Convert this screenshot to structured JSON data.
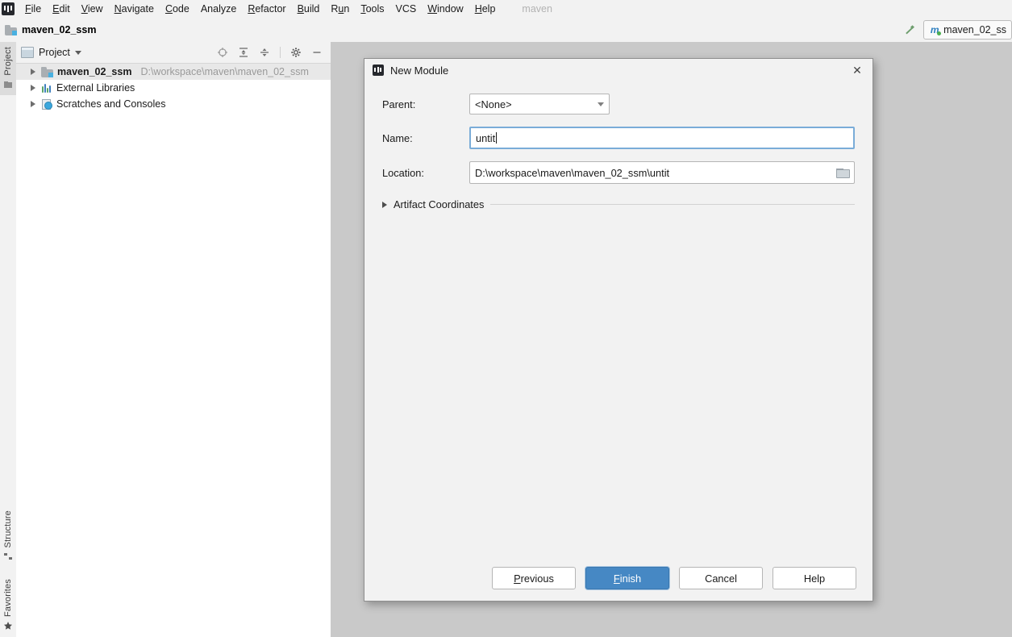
{
  "app": {
    "logo_icon": "intellij-logo-icon",
    "menu": [
      {
        "label": "File",
        "mnemonic": "F"
      },
      {
        "label": "Edit",
        "mnemonic": "E"
      },
      {
        "label": "View",
        "mnemonic": "V"
      },
      {
        "label": "Navigate",
        "mnemonic": "N"
      },
      {
        "label": "Code",
        "mnemonic": "C"
      },
      {
        "label": "Analyze",
        "mnemonic": "A"
      },
      {
        "label": "Refactor",
        "mnemonic": "R"
      },
      {
        "label": "Build",
        "mnemonic": "B"
      },
      {
        "label": "Run",
        "mnemonic": "u"
      },
      {
        "label": "Tools",
        "mnemonic": "T"
      },
      {
        "label": "VCS",
        "mnemonic": "V"
      },
      {
        "label": "Window",
        "mnemonic": "W"
      },
      {
        "label": "Help",
        "mnemonic": "H"
      }
    ],
    "menu_trailing_text": "maven"
  },
  "navbar": {
    "breadcrumb": "maven_02_ssm",
    "breadcrumb_icon": "project-folder-icon",
    "build_icon": "hammer-icon",
    "run_config": {
      "label": "maven_02_ss",
      "icon": "maven-icon"
    }
  },
  "rail": {
    "project_tab": "Project",
    "structure_tab": "Structure",
    "favorites_tab": "Favorites"
  },
  "project_panel": {
    "title": "Project",
    "title_icon": "project-window-icon",
    "tools": [
      {
        "name": "locate-icon"
      },
      {
        "name": "expand-all-icon"
      },
      {
        "name": "collapse-all-icon"
      },
      {
        "name": "settings-gear-icon"
      },
      {
        "name": "hide-window-icon"
      }
    ],
    "tree": [
      {
        "label": "maven_02_ssm",
        "path": "D:\\workspace\\maven\\maven_02_ssm",
        "icon": "project-folder-icon",
        "selected": true,
        "bold": true
      },
      {
        "label": "External Libraries",
        "path": "",
        "icon": "libraries-icon",
        "selected": false,
        "bold": false
      },
      {
        "label": "Scratches and Consoles",
        "path": "",
        "icon": "scratches-icon",
        "selected": false,
        "bold": false
      }
    ]
  },
  "dialog": {
    "title": "New Module",
    "title_icon": "intellij-logo-icon",
    "close_label": "✕",
    "fields": {
      "parent_label": "Parent:",
      "parent_value": "<None>",
      "name_label": "Name:",
      "name_value": "untit",
      "name_placeholder": "",
      "location_label": "Location:",
      "location_value": "D:\\workspace\\maven\\maven_02_ssm\\untit",
      "location_placeholder": "",
      "browse_icon": "folder-browse-icon"
    },
    "section": {
      "artifact_coordinates_label": "Artifact Coordinates",
      "expanded": false
    },
    "buttons": [
      {
        "label": "Previous",
        "mnemonic": "P",
        "primary": false
      },
      {
        "label": "Finish",
        "mnemonic": "F",
        "primary": true
      },
      {
        "label": "Cancel",
        "mnemonic": "",
        "primary": false
      },
      {
        "label": "Help",
        "mnemonic": "",
        "primary": false
      }
    ]
  },
  "colors": {
    "accent": "#4688c4",
    "focus_border": "#7aacd8",
    "panel_bg": "#f2f2f2",
    "editor_bg": "#c9c9c9",
    "tree_selection": "#e8e8e8"
  }
}
